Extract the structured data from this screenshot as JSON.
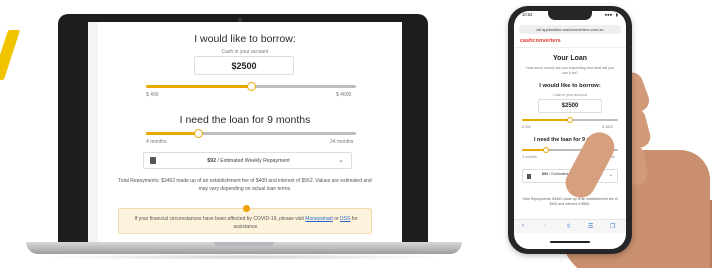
{
  "laptop": {
    "borrow_heading": "I would like to borrow:",
    "cash_label": "Cash in your account",
    "amount": "$2500",
    "amount_min": "$ 400",
    "amount_max": "$ 4600",
    "amount_fraction": 0.5,
    "term_heading": "I need the loan for 9 months",
    "term_min": "4 months",
    "term_max": "24 months",
    "term_fraction": 0.25,
    "repayment_amount": "$92",
    "repayment_label": "/ Estimated Weekly Repayment",
    "summary_text": "Total Repayments: $3462 made up of an establishment fee of $400 and interest of $562. Values are estimated and may vary depending on actual loan terms.",
    "notice_before": "If your financial circumstances have been affected by COVID-19, please visit",
    "notice_link1": "Moneysmart",
    "notice_mid": "or",
    "notice_link2": "DSS",
    "notice_after": "for assistance."
  },
  "phone": {
    "status_time": "10:52",
    "status_signal": "●●●  ▮",
    "url": "aA  application.cashconverters.com.au",
    "logo": "cashconverters",
    "title": "Your Loan",
    "description": "How much money are you requesting and what will you use it for?",
    "borrow_heading": "I would like to borrow:",
    "cash_label": "Cash in your account",
    "amount": "$2500",
    "amount_min": "$ 400",
    "amount_max": "$ 4600",
    "term_heading": "I need the loan for 9 months",
    "term_min": "4 months",
    "term_max": "24 months",
    "repayment_amount": "$92",
    "repayment_label": "/ Estimated Weekly Repayment",
    "summary_text": "Total Repayments: $3462 made up of an establishment fee of $400 and interest of $562."
  },
  "colors": {
    "accent": "#e8a800",
    "brand_red": "#e43a2a",
    "notice_bg": "#fdf3dd"
  },
  "icons": {
    "calendar": "calendar-icon",
    "chevron": "chevron-down-icon",
    "info": "info-icon"
  }
}
